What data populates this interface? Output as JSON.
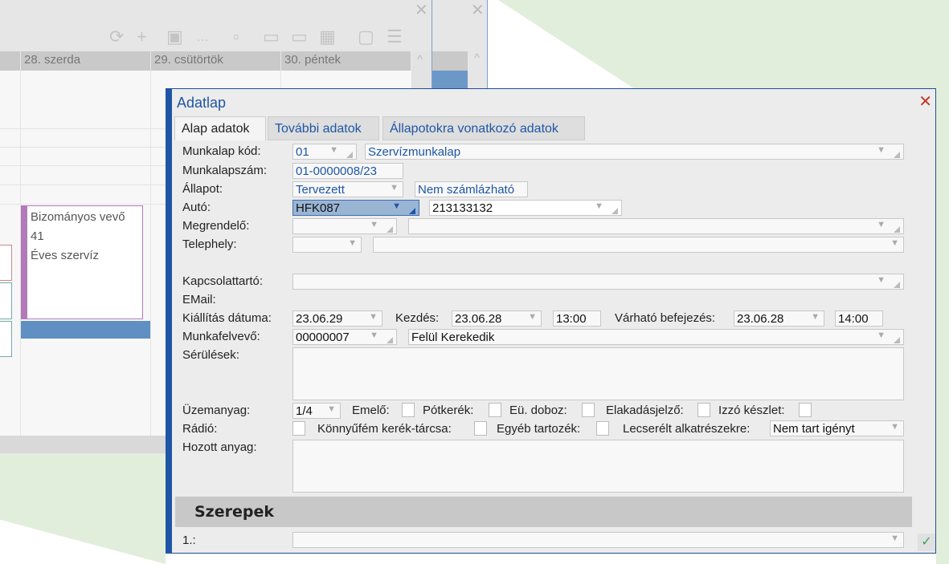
{
  "calendar": {
    "days": [
      "28. szerda",
      "29. csütörtök",
      "30. péntek"
    ],
    "event": {
      "lines": [
        "Bizományos vevő",
        "41",
        "Éves szervíz"
      ]
    }
  },
  "dialog": {
    "title": "Adatlap",
    "tabs": [
      "Alap adatok",
      "További adatok",
      "Állapotokra vonatkozó adatok"
    ],
    "labels": {
      "munkalap_kod": "Munkalap kód:",
      "munkalapszam": "Munkalapszám:",
      "allapot": "Állapot:",
      "auto": "Autó:",
      "megrendelo": "Megrendelő:",
      "telephely": "Telephely:",
      "kapcsolattarto": "Kapcsolattartó:",
      "email": "EMail:",
      "kiallitas": "Kiállítás dátuma:",
      "kezdes": "Kezdés:",
      "varhato": "Várható befejezés:",
      "munkafelvevo": "Munkafelvevő:",
      "serulesek": "Sérülések:",
      "uzemanyag": "Üzemanyag:",
      "emelo": "Emelő:",
      "potkerek": "Pótkerék:",
      "eudoboz": "Eü. doboz:",
      "elakadas": "Elakadásjelző:",
      "izzo": "Izzó készlet:",
      "radio": "Rádió:",
      "konnyufem": "Könnyűfém kerék-tárcsa:",
      "egyeb": "Egyéb tartozék:",
      "lecserelt": "Lecserélt alkatrészekre:",
      "hozott": "Hozott anyag:"
    },
    "values": {
      "munkalap_kod": "01",
      "munkalap_tipus": "Szervízmunkalap",
      "munkalapszam": "01-0000008/23",
      "allapot": "Tervezett",
      "szamlazas": "Nem számlázható",
      "auto": "HFK087",
      "auto_kod": "213133132",
      "kiallitas": "23.06.29",
      "kezdes_datum": "23.06.28",
      "kezdes_ido": "13:00",
      "varhato_datum": "23.06.28",
      "varhato_ido": "14:00",
      "munkafelvevo_kod": "00000007",
      "munkafelvevo_nev": "Felül Kerekedik",
      "uzemanyag": "1/4",
      "lecserelt": "Nem tart igényt"
    },
    "section": "Szerepek",
    "role_label": "1.:"
  }
}
